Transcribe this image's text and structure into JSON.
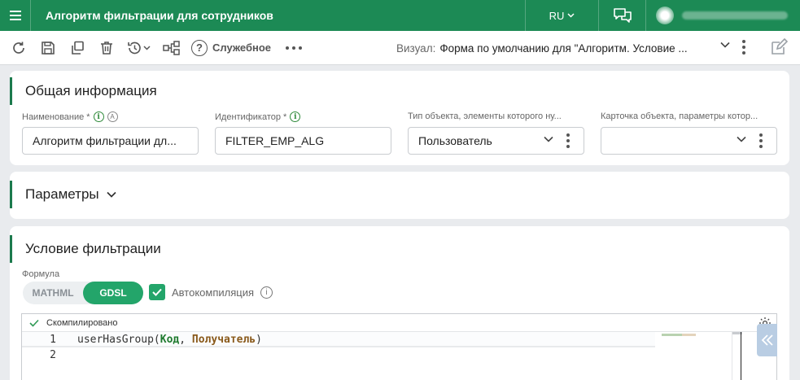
{
  "header": {
    "title": "Алгоритм фильтрации для сотрудников",
    "language": "RU"
  },
  "toolbar": {
    "help_label": "Служебное",
    "visual_label": "Визуал:",
    "visual_value": "Форма по умолчанию для \"Алгоритм. Условие ..."
  },
  "general": {
    "title": "Общая информация",
    "fields": [
      {
        "label": "Наименование *",
        "value": "Алгоритм фильтрации дл..."
      },
      {
        "label": "Идентификатор *",
        "value": "FILTER_EMP_ALG"
      },
      {
        "label": "Тип объекта, элементы которого ну...",
        "value": "Пользователь"
      },
      {
        "label": "Карточка объекта, параметры котор...",
        "value": ""
      }
    ]
  },
  "params": {
    "title": "Параметры"
  },
  "filter": {
    "title": "Условие фильтрации",
    "formula_label": "Формула",
    "toggle": {
      "options": [
        "MATHML",
        "GDSL"
      ],
      "selected": "GDSL"
    },
    "autocompile_label": "Автокомпиляция",
    "autocompile_checked": true,
    "status": "Скомпилировано",
    "line_numbers": [
      "1",
      "2"
    ],
    "code": {
      "fn": "userHasGroup",
      "open": "(",
      "arg1": "Код",
      "sep": ", ",
      "arg2": "Получатель",
      "close": ")"
    }
  },
  "icons": [
    "menu-icon",
    "chevron-down-icon",
    "chat-icon",
    "refresh-icon",
    "save-icon",
    "copy-icon",
    "delete-icon",
    "history-icon",
    "structure-icon",
    "help-icon",
    "more-icon",
    "kebab-icon",
    "edit-icon",
    "info-icon",
    "check-icon",
    "gear-icon",
    "double-chevron-left-icon"
  ],
  "colors": {
    "brand": "#1c8a55",
    "accent": "#23a56a"
  }
}
